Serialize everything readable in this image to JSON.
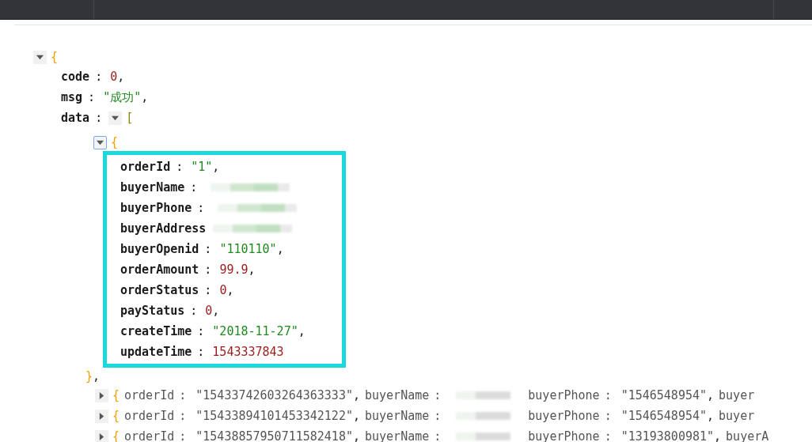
{
  "root": {
    "expanded": true,
    "open": "{",
    "fields": [
      {
        "key": "code",
        "colon": ":",
        "kind": "number",
        "value": "0",
        "comma": ","
      },
      {
        "key": "msg",
        "colon": ":",
        "kind": "string",
        "value": "\"成功\"",
        "comma": ","
      },
      {
        "key": "data",
        "colon": ":",
        "kind": "array",
        "expanded": true,
        "open": "[",
        "items": [
          {
            "expanded": true,
            "highlighted": true,
            "open": "{",
            "close": "}",
            "comma": ",",
            "fields": [
              {
                "key": "orderId",
                "colon": ":",
                "kind": "string",
                "value": "\"1\"",
                "comma": ","
              },
              {
                "key": "buyerName",
                "colon": ":",
                "kind": "blurred"
              },
              {
                "key": "buyerPhone",
                "colon": ":",
                "kind": "blurred"
              },
              {
                "key": "buyerAddress",
                "kind": "blurred"
              },
              {
                "key": "buyerOpenid",
                "colon": ":",
                "kind": "string",
                "value": "\"110110\"",
                "comma": ","
              },
              {
                "key": "orderAmount",
                "colon": ":",
                "kind": "number",
                "value": "99.9",
                "comma": ","
              },
              {
                "key": "orderStatus",
                "colon": ":",
                "kind": "number",
                "value": "0",
                "comma": ","
              },
              {
                "key": "payStatus",
                "colon": ":",
                "kind": "number",
                "value": "0",
                "comma": ","
              },
              {
                "key": "createTime",
                "colon": ":",
                "kind": "string",
                "value": "\"2018-11-27\"",
                "comma": ","
              },
              {
                "key": "updateTime",
                "colon": ":",
                "kind": "number",
                "value": "1543337843"
              }
            ]
          },
          {
            "expanded": false,
            "open": "{",
            "fields": [
              {
                "key": "orderId",
                "colon": ":",
                "kind": "string",
                "value": "\"15433742603264363333\"",
                "comma": ","
              },
              {
                "key": "buyerName",
                "colon": ":",
                "kind": "blurred"
              },
              {
                "key": "buyerPhone",
                "colon": ":",
                "kind": "string",
                "value": "\"1546548954\"",
                "comma": ","
              },
              {
                "key": "buyer",
                "kind": "cut"
              }
            ]
          },
          {
            "expanded": false,
            "open": "{",
            "fields": [
              {
                "key": "orderId",
                "colon": ":",
                "kind": "string",
                "value": "\"15433894101453342122\"",
                "comma": ","
              },
              {
                "key": "buyerName",
                "colon": ":",
                "kind": "blurred"
              },
              {
                "key": "buyerPhone",
                "colon": ":",
                "kind": "string",
                "value": "\"1546548954\"",
                "comma": ","
              },
              {
                "key": "buyer",
                "kind": "cut"
              }
            ]
          },
          {
            "expanded": false,
            "open": "{",
            "fields": [
              {
                "key": "orderId",
                "colon": ":",
                "kind": "string",
                "value": "\"15438857950711582418\"",
                "comma": ","
              },
              {
                "key": "buyerName",
                "colon": ":",
                "kind": "blurred"
              },
              {
                "key": "buyerPhone",
                "colon": ":",
                "kind": "string",
                "value": "\"13193800981\"",
                "comma": ","
              },
              {
                "key": "buyerA",
                "kind": "cut"
              }
            ]
          }
        ]
      }
    ]
  }
}
